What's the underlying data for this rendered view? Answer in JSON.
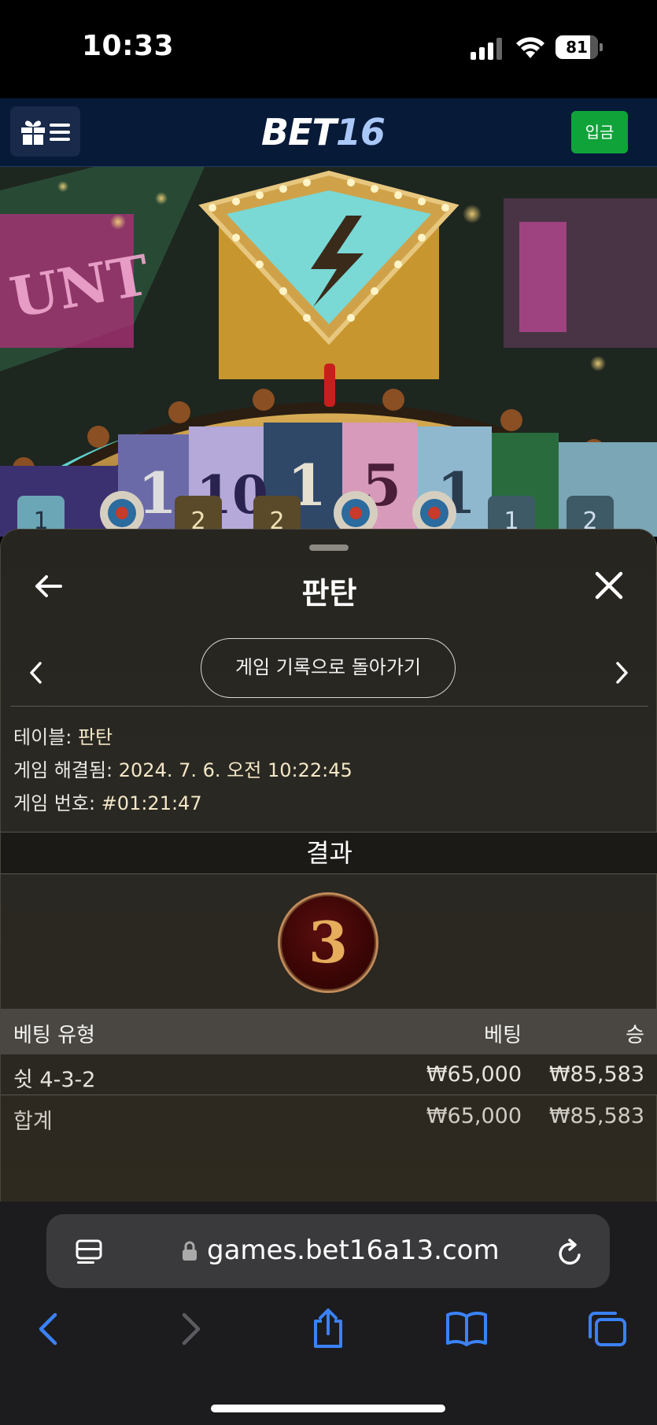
{
  "status_bar": {
    "time": "10:33",
    "battery": "81"
  },
  "header": {
    "logo_bet": "BET",
    "logo_num": "16",
    "deposit_label": "입금"
  },
  "wheel": {
    "segments": [
      "1",
      "2",
      "10",
      "2",
      "1",
      "5",
      "1",
      "1",
      "2"
    ]
  },
  "panel": {
    "title": "판탄",
    "history_button": "게임 기록으로 돌아가기",
    "table_label": "테이블:",
    "table_value": "판탄",
    "resolved_label": "게임 해결됨:",
    "resolved_value": "2024. 7. 6. 오전 10:22:45",
    "game_no_label": "게임 번호:",
    "game_no_value": "#01:21:47",
    "result_header": "결과",
    "result_value": "3"
  },
  "bets": {
    "columns": {
      "type": "베팅 유형",
      "bet": "베팅",
      "win": "승"
    },
    "rows": [
      {
        "type": "쉿 4-3-2",
        "bet": "₩65,000",
        "win": "₩85,583"
      }
    ],
    "total": {
      "label": "합계",
      "bet": "₩65,000",
      "win": "₩85,583"
    }
  },
  "browser": {
    "url": "games.bet16a13.com"
  },
  "colors": {
    "brand_navy": "#071a38",
    "deposit_green": "#10a33a",
    "safari_blue": "#3a82f7"
  }
}
